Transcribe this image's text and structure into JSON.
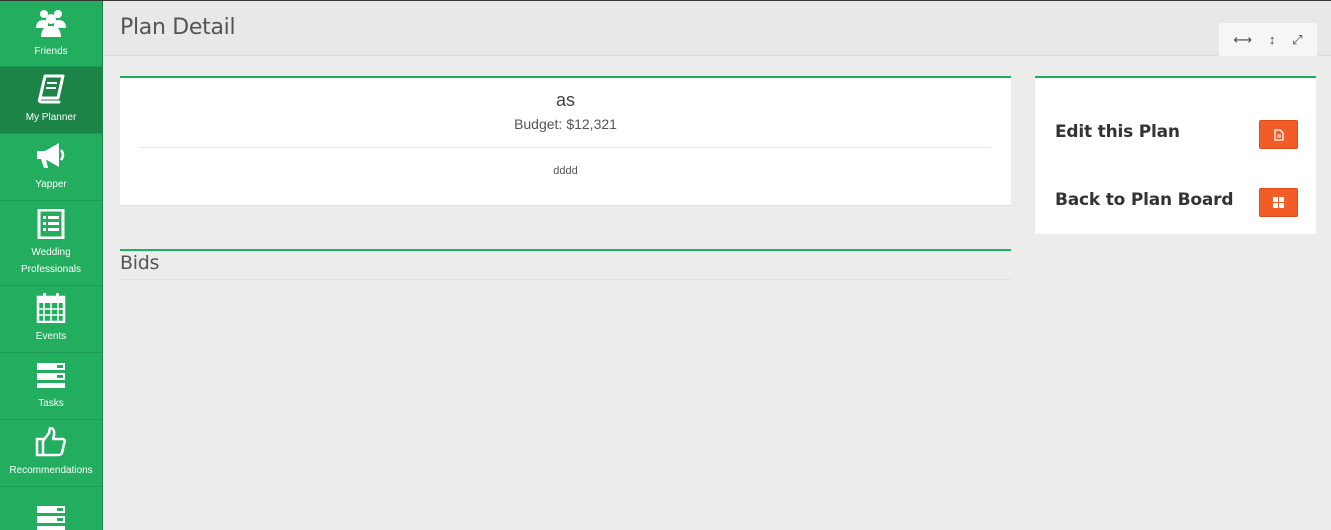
{
  "sidebar": {
    "items": [
      {
        "label": "Friends",
        "icon": "friends-icon"
      },
      {
        "label": "My Planner",
        "icon": "book-icon"
      },
      {
        "label": "Yapper",
        "icon": "megaphone-icon"
      },
      {
        "label": "Wedding Professionals",
        "icon": "list-icon"
      },
      {
        "label": "Events",
        "icon": "calendar-icon"
      },
      {
        "label": "Tasks",
        "icon": "tasks-icon"
      },
      {
        "label": "Recommendations",
        "icon": "thumbs-up-icon"
      },
      {
        "label": "",
        "icon": "tasks-icon"
      }
    ],
    "active_index": 1,
    "colors": {
      "bg": "#23ad5f",
      "active": "#1d8447"
    }
  },
  "header": {
    "title": "Plan Detail",
    "controls": [
      {
        "icon": "resize-horizontal-icon",
        "glyph": "⟷"
      },
      {
        "icon": "resize-vertical-icon",
        "glyph": "↕"
      },
      {
        "icon": "fullscreen-icon",
        "glyph": "⤢"
      }
    ]
  },
  "plan": {
    "name": "as",
    "budget_label": "Budget:",
    "budget_value": "$12,321",
    "description": "dddd"
  },
  "bids": {
    "title": "Bids"
  },
  "actions": {
    "edit_label": "Edit this Plan",
    "edit_icon": "document-icon",
    "back_label": "Back to Plan Board",
    "back_icon": "grid-icon",
    "button_color": "#f25d27"
  }
}
